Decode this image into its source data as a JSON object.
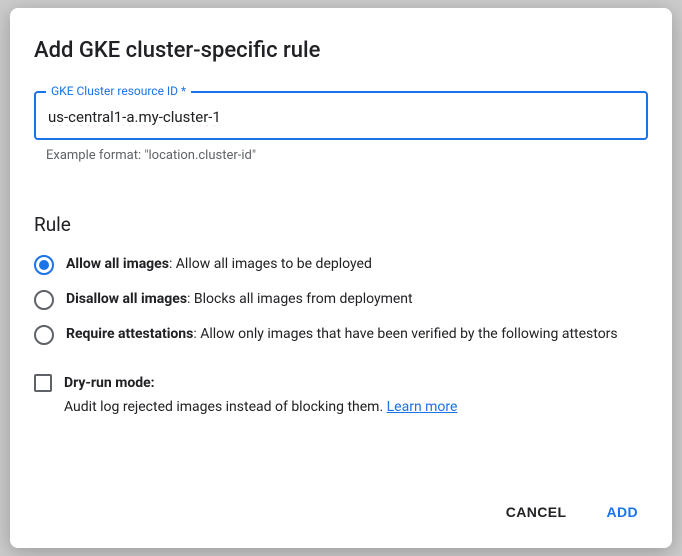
{
  "dialog": {
    "title": "Add GKE cluster-specific rule",
    "field": {
      "label": "GKE Cluster resource ID *",
      "value": "us-central1-a.my-cluster-1",
      "hint": "Example format: \"location.cluster-id\""
    },
    "rule_section": {
      "heading": "Rule",
      "options": {
        "allow": {
          "label": "Allow all images",
          "desc": ": Allow all images to be deployed"
        },
        "disallow": {
          "label": "Disallow all images",
          "desc": ": Blocks all images from deployment"
        },
        "attest": {
          "label": "Require attestations",
          "desc": ": Allow only images that have been verified by the following attestors"
        }
      },
      "dry_run": {
        "label": "Dry-run mode:",
        "desc": "Audit log rejected images instead of blocking them. ",
        "link": "Learn more"
      }
    },
    "actions": {
      "cancel": "CANCEL",
      "add": "ADD"
    }
  }
}
